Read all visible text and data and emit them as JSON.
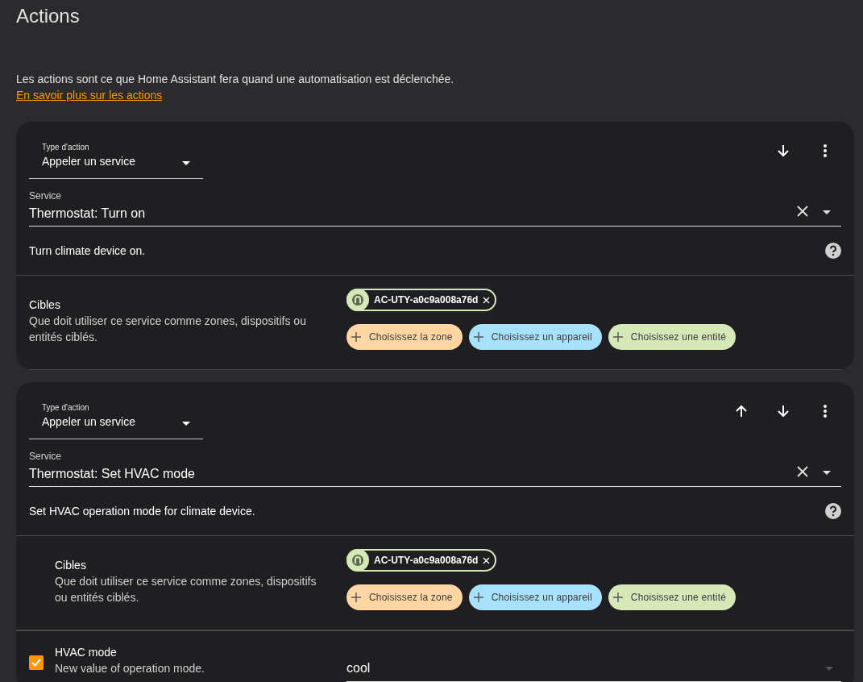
{
  "title": "Actions",
  "description": "Les actions sont ce que Home Assistant fera quand une automatisation est déclenchée.",
  "link": "En savoir plus sur les actions",
  "actions": [
    {
      "type_label": "Type d'action",
      "type_value": "Appeler un service",
      "move_up": false,
      "move_down": true,
      "service_label": "Service",
      "service_value": "Thermostat: Turn on",
      "service_description": "Turn climate device on.",
      "targets": {
        "title": "Cibles",
        "description": "Que doit utiliser ce service comme zones, dispositifs ou entités ciblés.",
        "chips": [
          "AC-UTY-a0c9a008a76d"
        ],
        "pickers": [
          {
            "label": "Choisissez la zone",
            "color": "#fed6a4"
          },
          {
            "label": "Choisissez un appareil",
            "color": "#a8e1fb"
          },
          {
            "label": "Choisissez une entité",
            "color": "#d4e8b8"
          }
        ]
      }
    },
    {
      "type_label": "Type d'action",
      "type_value": "Appeler un service",
      "move_up": true,
      "move_down": true,
      "service_label": "Service",
      "service_value": "Thermostat: Set HVAC mode",
      "service_description": "Set HVAC operation mode for climate device.",
      "targets": {
        "title": "Cibles",
        "description": "Que doit utiliser ce service comme zones, dispositifs ou entités ciblés.",
        "chips": [
          "AC-UTY-a0c9a008a76d"
        ],
        "pickers": [
          {
            "label": "Choisissez la zone",
            "color": "#fed6a4"
          },
          {
            "label": "Choisissez un appareil",
            "color": "#a8e1fb"
          },
          {
            "label": "Choisissez une entité",
            "color": "#d4e8b8"
          }
        ]
      },
      "fields": [
        {
          "name": "HVAC mode",
          "description": "New value of operation mode.",
          "checked": true,
          "value": "cool"
        }
      ]
    }
  ]
}
